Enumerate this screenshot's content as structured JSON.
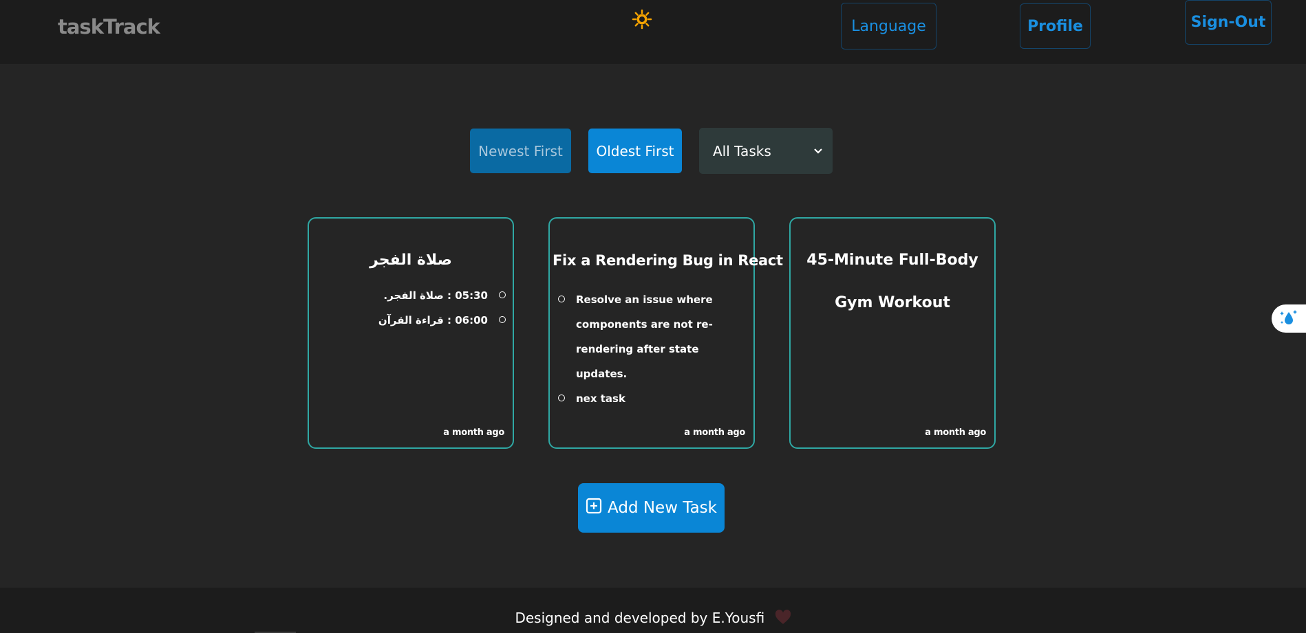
{
  "header": {
    "brand": "taskTrack",
    "theme_icon": "sun-icon",
    "language_label": "Language",
    "profile_label": "Profile",
    "signout_label": "Sign-Out",
    "accent_color": "#1a8fe0"
  },
  "controls": {
    "newest_label": "Newest First",
    "oldest_label": "Oldest First",
    "filter_selected": "All Tasks"
  },
  "tasks": [
    {
      "title": "صلاة الفجر",
      "direction": "rtl",
      "items": [
        "05:30 : صلاة الفجر.",
        "06:00 : قراءة القرآن"
      ],
      "time": "a month ago"
    },
    {
      "title": "Fix a Rendering Bug in React",
      "direction": "ltr",
      "items": [
        "Resolve an issue where components are not re-rendering after state updates.",
        "nex task"
      ],
      "time": "a month ago"
    },
    {
      "title": "45-Minute Full-Body Gym Workout",
      "direction": "ltr",
      "items": [],
      "time": "a month ago"
    }
  ],
  "add_task_label": "Add New Task",
  "add_task_icon": "plus-square-icon",
  "footer": {
    "text": "Designed and developed by E.Yousfi",
    "heart_icon": "heart-icon"
  },
  "colors": {
    "background": "#252525",
    "navbar": "#1c1c1c",
    "card_border": "#2fa8a4",
    "primary_button": "#0a86d6"
  }
}
